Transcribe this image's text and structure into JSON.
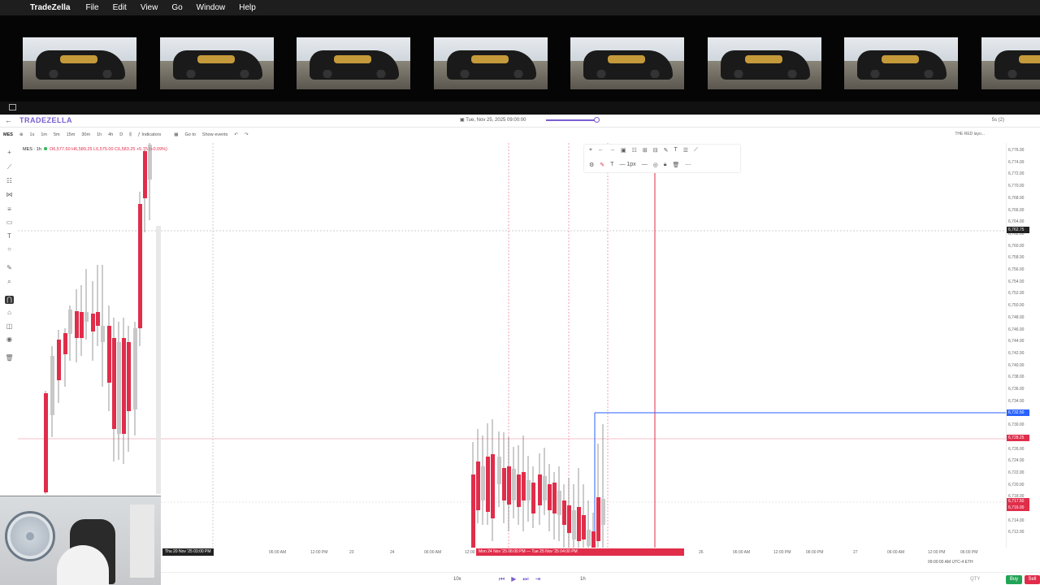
{
  "menubar": {
    "app_name": "TradeZella",
    "items": [
      "File",
      "Edit",
      "View",
      "Go",
      "Window",
      "Help"
    ]
  },
  "app_header": {
    "logo": "TRADEZELLA",
    "replay_datetime": "Tue, Nov 25, 2025 09:00:00",
    "speed": "5s (2)"
  },
  "chart_toolbar": {
    "symbol": "MES",
    "timeframes": [
      "1s",
      "1m",
      "5m",
      "15m",
      "30m",
      "1h",
      "4h",
      "D"
    ],
    "indicators_label": "Indicators",
    "goto_label": "Go to",
    "events_label": "Show events",
    "right_label": "THE RED layo..."
  },
  "legend": {
    "title": "MES · 1h",
    "values": "O6,577.50 H6,589.25 L6,575.00 C6,583.25 +5.75 (+0.09%)"
  },
  "floating_toolbar": {
    "speed_label": "1px"
  },
  "price_axis": {
    "ticks": [
      "6,776.00",
      "6,774.00",
      "6,772.00",
      "6,770.00",
      "6,768.00",
      "6,766.00",
      "6,764.00",
      "6,762.00",
      "6,760.00",
      "6,758.00",
      "6,756.00",
      "6,754.00",
      "6,752.00",
      "6,750.00",
      "6,748.00",
      "6,746.00",
      "6,744.00",
      "6,742.00",
      "6,740.00",
      "6,738.00",
      "6,736.00",
      "6,734.00",
      "6,732.00",
      "6,730.00",
      "6,728.00",
      "6,726.00",
      "6,724.00",
      "6,722.00",
      "6,720.00",
      "6,718.00",
      "6,716.00",
      "6,714.00",
      "6,712.00"
    ],
    "crosshair_price": "6,762.75",
    "blue_tag": "6,732.50",
    "red_tag_1": "6,728.25",
    "red_tag_2": "6,717.50",
    "red_tag_3": "6,716.00"
  },
  "time_axis": {
    "crosshair_time": "Thu 20 Nov '25 03:00 PM",
    "range_label": "Mon 24 Nov '25 06:00 PM — Tue 25 Nov '25 04:00 PM",
    "ticks": [
      {
        "label": "06:00 AM"
      },
      {
        "label": "12:00 PM"
      },
      {
        "label": "23"
      },
      {
        "label": "24"
      },
      {
        "label": "06:00 AM"
      },
      {
        "label": "12:00"
      },
      {
        "label": "26"
      },
      {
        "label": "06:00 AM"
      },
      {
        "label": "12:00 PM"
      },
      {
        "label": "06:00 PM"
      },
      {
        "label": "27"
      },
      {
        "label": "06:00 AM"
      },
      {
        "label": "12:00 PM"
      },
      {
        "label": "06:00 PM"
      }
    ],
    "timezone": "09:00:00 AM UTC-4  ETH"
  },
  "footer": {
    "zoom": "10x",
    "timeframe": "1h",
    "qty_label": "QTY",
    "buy_label": "Buy",
    "sell_label": "Sell"
  },
  "colors": {
    "bull": "#c8c8c8",
    "bear": "#e02d4a",
    "accent": "#7a5ed0",
    "blue_line": "#2962ff"
  }
}
